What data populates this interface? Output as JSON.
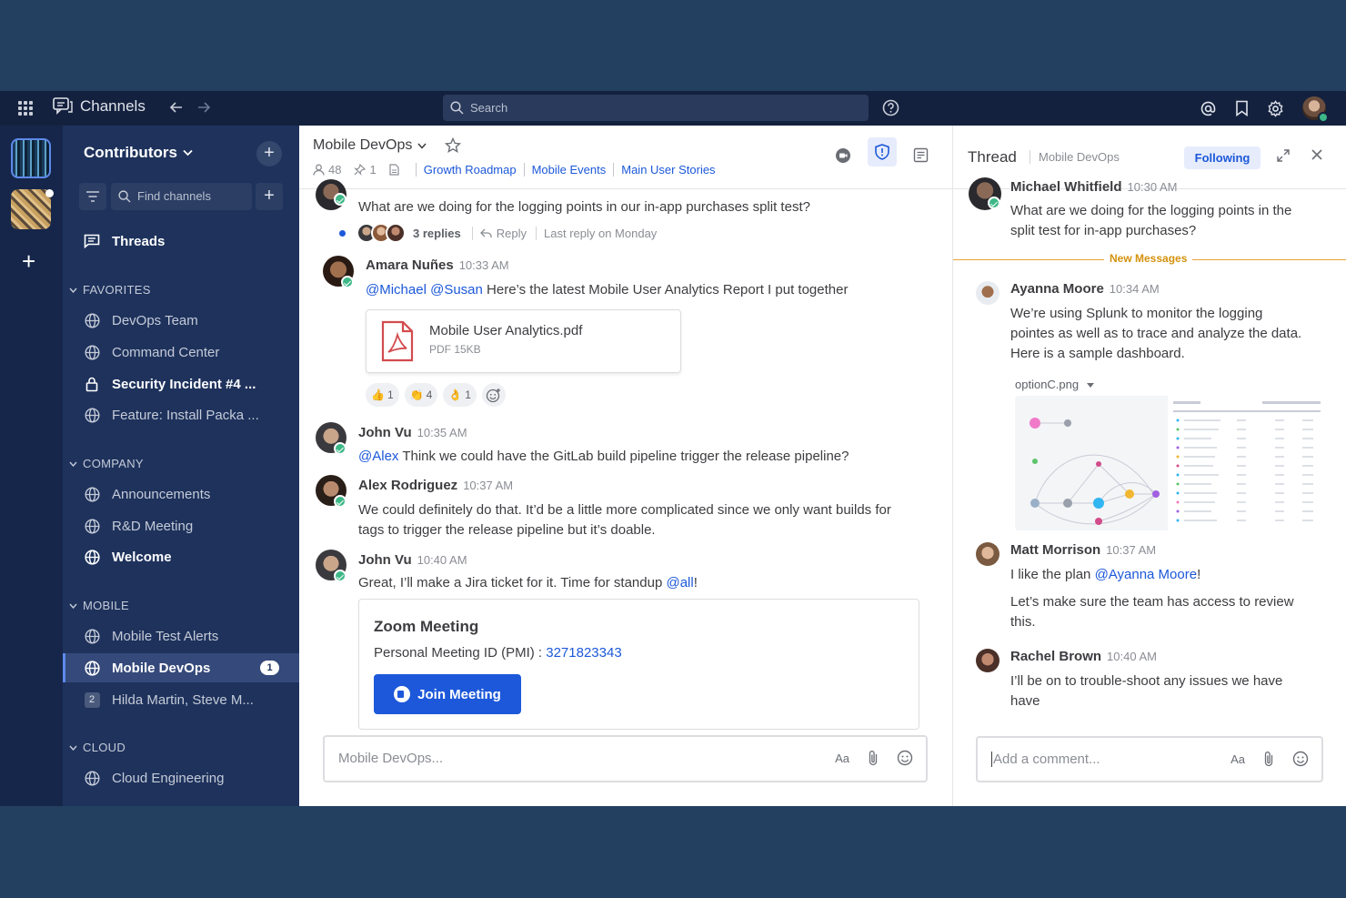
{
  "topbar": {
    "brand": "Channels",
    "search_placeholder": "Search"
  },
  "sidebar": {
    "team_name": "Contributors",
    "find_placeholder": "Find channels",
    "threads_label": "Threads",
    "sections": [
      {
        "title": "FAVORITES",
        "items": [
          "DevOps Team",
          "Command Center",
          "Security Incident #4 ...",
          "Feature: Install Packa ..."
        ]
      },
      {
        "title": "COMPANY",
        "items": [
          "Announcements",
          "R&D Meeting",
          "Welcome"
        ]
      },
      {
        "title": "MOBILE",
        "items": [
          "Mobile Test Alerts",
          "Mobile DevOps",
          "Hilda Martin, Steve M..."
        ]
      },
      {
        "title": "CLOUD",
        "items": [
          "Cloud Engineering"
        ]
      }
    ],
    "active_badge": "1",
    "dm_count": "2"
  },
  "channel": {
    "name": "Mobile DevOps",
    "members": "48",
    "pinned": "1",
    "links": [
      "Growth Roadmap",
      "Mobile Events",
      "Main User Stories"
    ]
  },
  "messages": {
    "m0": {
      "text": "What are we doing for the logging points in our in-app purchases split test?",
      "replies": "3 replies",
      "reply": "Reply",
      "last_reply": "Last reply on Monday"
    },
    "m1": {
      "name": "Amara Nuñes",
      "time": "10:33 AM",
      "mention1": "@Michael",
      "mention2": "@Susan",
      "text": "Here’s the latest Mobile User Analytics Report I put together",
      "file_name": "Mobile User Analytics.pdf",
      "file_meta": "PDF 15KB",
      "reactions": [
        {
          "emoji": "👍",
          "count": "1"
        },
        {
          "emoji": "👏",
          "count": "4"
        },
        {
          "emoji": "👌",
          "count": "1"
        }
      ]
    },
    "m2": {
      "name": "John Vu",
      "time": "10:35 AM",
      "mention": "@Alex",
      "text": "Think we could have the GitLab build pipeline trigger the release pipeline?"
    },
    "m3": {
      "name": "Alex Rodriguez",
      "time": "10:37 AM",
      "line1": "We could definitely do that. It’d be a little more complicated since we only want builds for",
      "line2": "tags to trigger the release pipeline but it’s doable."
    },
    "m4": {
      "name": "John Vu",
      "time": "10:40 AM",
      "text": "Great, I’ll make a Jira ticket for it. Time for standup",
      "mention": "@all",
      "end": "!",
      "zoom_title": "Zoom Meeting",
      "zoom_label": "Personal Meeting ID (PMI) :",
      "zoom_id": "3271823343",
      "join_label": "Join Meeting"
    }
  },
  "composer": {
    "placeholder": "Mobile DevOps...",
    "format": "Aa"
  },
  "thread": {
    "title": "Thread",
    "channel": "Mobile DevOps",
    "following": "Following",
    "root_name": "Michael Whitfield",
    "root_time": "10:30 AM",
    "root_line1": "What are we doing for the logging points in the",
    "root_line2": "split test for in-app purchases?",
    "new_messages": "New Messages",
    "r1": {
      "name": "Ayanna Moore",
      "time": "10:34 AM",
      "line1": "We’re using Splunk to monitor the logging",
      "line2": "pointes as well as to trace and analyze the data.",
      "line3": "Here is a sample dashboard.",
      "image_name": "optionC.png"
    },
    "r2": {
      "name": "Matt Morrison",
      "time": "10:37 AM",
      "text": "I like the plan",
      "mention": "@Ayanna Moore",
      "end": "!",
      "line2a": "Let’s make sure the team has access to review",
      "line2b": "this."
    },
    "r3": {
      "name": "Rachel Brown",
      "time": "10:40 AM",
      "line1": "I’ll be on to trouble-shoot any issues we have",
      "line2": "have"
    },
    "composer_placeholder": "Add a comment...",
    "format": "Aa"
  },
  "colors": {
    "accent": "#1c58d9",
    "online": "#3db887",
    "sidebar": "#1e325c",
    "new_messages": "#e8a339"
  }
}
